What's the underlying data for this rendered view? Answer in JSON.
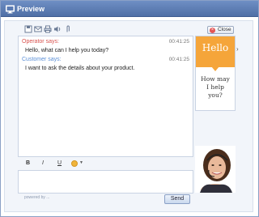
{
  "window": {
    "title": "Preview"
  },
  "toolbar": {
    "icons": [
      "save-icon",
      "email-icon",
      "print-icon",
      "sound-icon",
      "attach-icon"
    ]
  },
  "close_button": {
    "label": "Close"
  },
  "messages": [
    {
      "sender": "Operator says:",
      "time": "00:41:25",
      "text": "Hello, what can I help you today?",
      "role": "operator"
    },
    {
      "sender": "Customer says:",
      "time": "00:41:25",
      "text": "I want to ask the details about your product.",
      "role": "customer"
    }
  ],
  "format": {
    "bold": "B",
    "italic": "I",
    "underline": "U"
  },
  "footer": {
    "powered": "powered by ...",
    "send_label": "Send"
  },
  "ad": {
    "hello": "Hello",
    "question_lines": [
      "How may",
      "I help",
      "you?"
    ]
  },
  "colors": {
    "operator": "#d9534f",
    "customer": "#5b8fd6",
    "accent": "#f5a53a",
    "titlebar": "#5b7bb3"
  }
}
